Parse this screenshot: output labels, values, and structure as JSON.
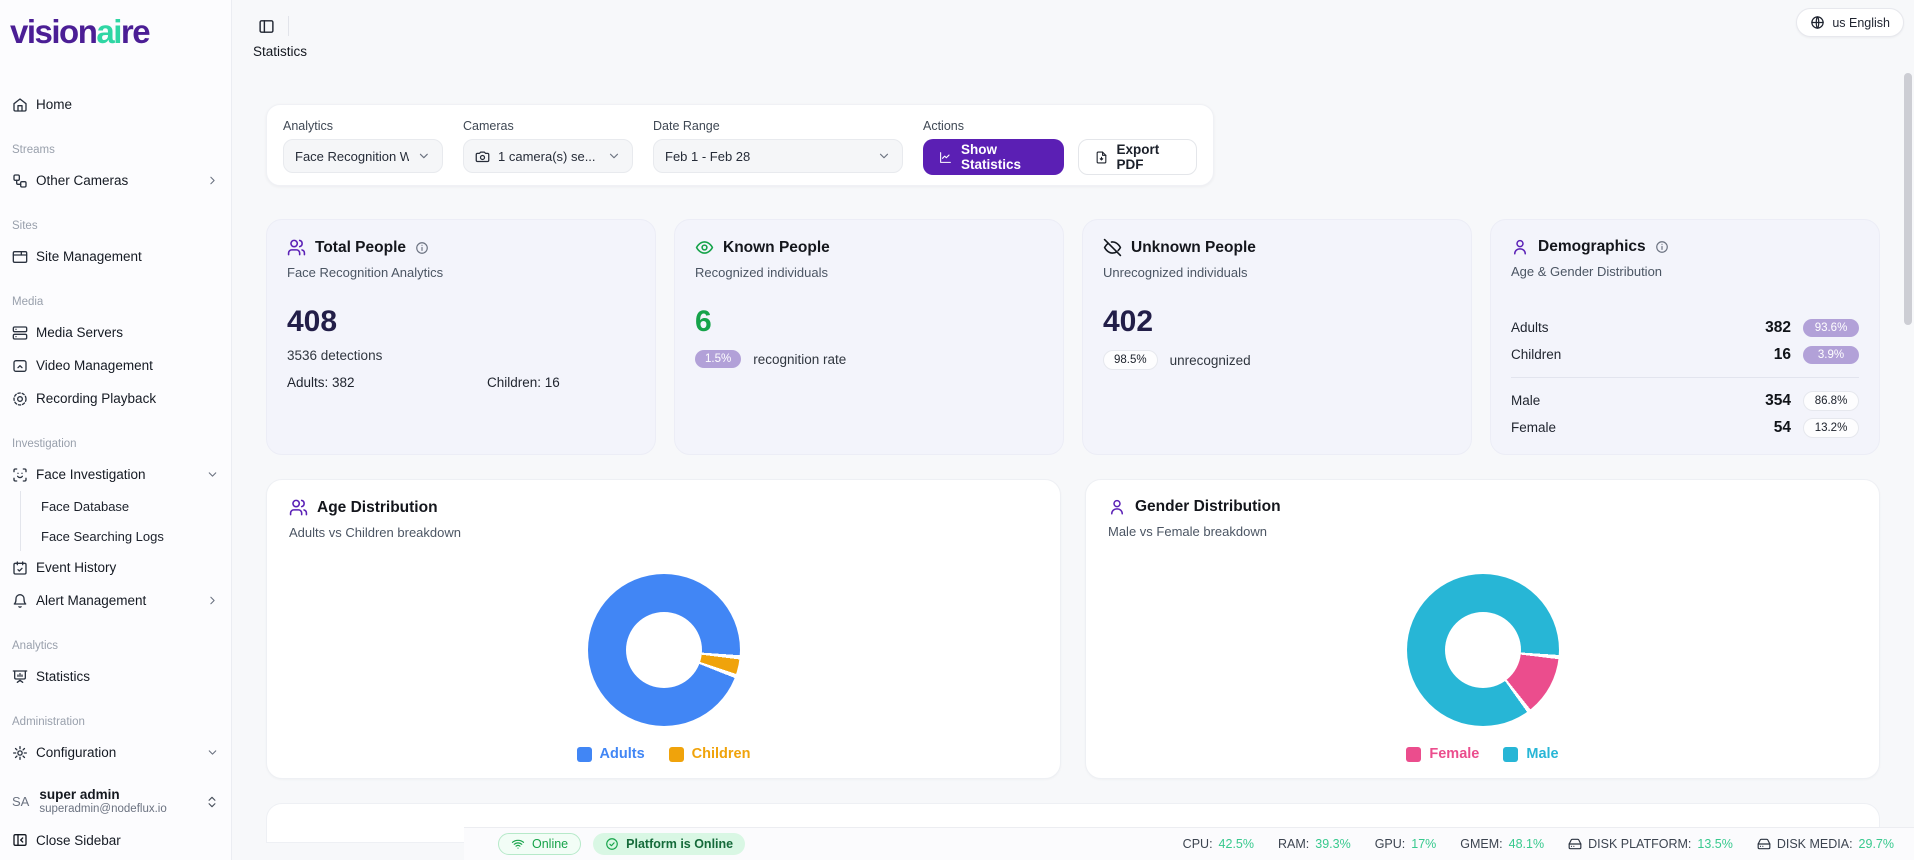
{
  "brand": {
    "logo_part1": "vision",
    "logo_part2": "ai",
    "logo_part3": "re"
  },
  "header": {
    "title": "Statistics",
    "language": "us English"
  },
  "sidebar": {
    "home": "Home",
    "streams_label": "Streams",
    "other_cameras": "Other Cameras",
    "sites_label": "Sites",
    "site_management": "Site Management",
    "media_label": "Media",
    "media_servers": "Media Servers",
    "video_management": "Video Management",
    "recording_playback": "Recording Playback",
    "investigation_label": "Investigation",
    "face_investigation": "Face Investigation",
    "face_database": "Face Database",
    "face_searching_logs": "Face Searching Logs",
    "event_history": "Event History",
    "alert_management": "Alert Management",
    "analytics_label": "Analytics",
    "statistics": "Statistics",
    "administration_label": "Administration",
    "configuration": "Configuration",
    "user": {
      "initials": "SA",
      "name": "super admin",
      "email": "superadmin@nodeflux.io"
    },
    "close_sidebar": "Close Sidebar"
  },
  "filters": {
    "analytics_label": "Analytics",
    "analytics_value": "Face Recognition W",
    "cameras_label": "Cameras",
    "cameras_value": "1 camera(s) se...",
    "date_label": "Date Range",
    "date_value": "Feb 1 - Feb 28",
    "actions_label": "Actions",
    "show_statistics": "Show Statistics",
    "export_pdf": "Export PDF"
  },
  "cards": {
    "total_people": {
      "title": "Total People",
      "subtitle": "Face Recognition Analytics",
      "value": "408",
      "detections": "3536 detections",
      "adults": "Adults: 382",
      "children": "Children: 16"
    },
    "known_people": {
      "title": "Known People",
      "subtitle": "Recognized individuals",
      "value": "6",
      "badge": "1.5%",
      "badge_label": "recognition rate"
    },
    "unknown_people": {
      "title": "Unknown People",
      "subtitle": "Unrecognized individuals",
      "value": "402",
      "badge": "98.5%",
      "badge_label": "unrecognized"
    },
    "demographics": {
      "title": "Demographics",
      "subtitle": "Age & Gender Distribution",
      "rows": [
        {
          "label": "Adults",
          "value": "382",
          "badge": "93.6%",
          "style": "purple"
        },
        {
          "label": "Children",
          "value": "16",
          "badge": "3.9%",
          "style": "purple"
        },
        {
          "label": "Male",
          "value": "354",
          "badge": "86.8%",
          "style": "outline"
        },
        {
          "label": "Female",
          "value": "54",
          "badge": "13.2%",
          "style": "outline"
        }
      ]
    }
  },
  "chart_data": [
    {
      "type": "pie",
      "title": "Age Distribution",
      "subtitle": "Adults vs Children breakdown",
      "labels": [
        "Adults",
        "Children"
      ],
      "values": [
        382,
        16
      ],
      "percentages": [
        93.6,
        3.9
      ],
      "colors": [
        "#4186f5",
        "#f0a30b"
      ],
      "rotation_deg": 110,
      "donut_hole": 0.5,
      "legend_position": "bottom",
      "legend": [
        {
          "label": "Adults",
          "color": "#4186f5"
        },
        {
          "label": "Children",
          "color": "#f0a30b"
        }
      ]
    },
    {
      "type": "pie",
      "title": "Gender Distribution",
      "subtitle": "Male vs Female breakdown",
      "labels": [
        "Male",
        "Female"
      ],
      "values": [
        354,
        54
      ],
      "percentages": [
        86.8,
        13.2
      ],
      "colors": [
        "#27b6d6",
        "#eb4d8d"
      ],
      "rotation_deg": 143,
      "donut_hole": 0.5,
      "legend_position": "bottom",
      "legend": [
        {
          "label": "Female",
          "color": "#eb4d8d"
        },
        {
          "label": "Male",
          "color": "#27b6d6"
        }
      ]
    }
  ],
  "statusbar": {
    "online": "Online",
    "platform": "Platform is Online",
    "stats": [
      {
        "label": "CPU:",
        "value": "42.5%"
      },
      {
        "label": "RAM:",
        "value": "39.3%"
      },
      {
        "label": "GPU:",
        "value": "17%"
      },
      {
        "label": "GMEM:",
        "value": "48.1%"
      },
      {
        "label": "DISK PLATFORM:",
        "value": "13.5%"
      },
      {
        "label": "DISK MEDIA:",
        "value": "29.7%"
      }
    ]
  }
}
